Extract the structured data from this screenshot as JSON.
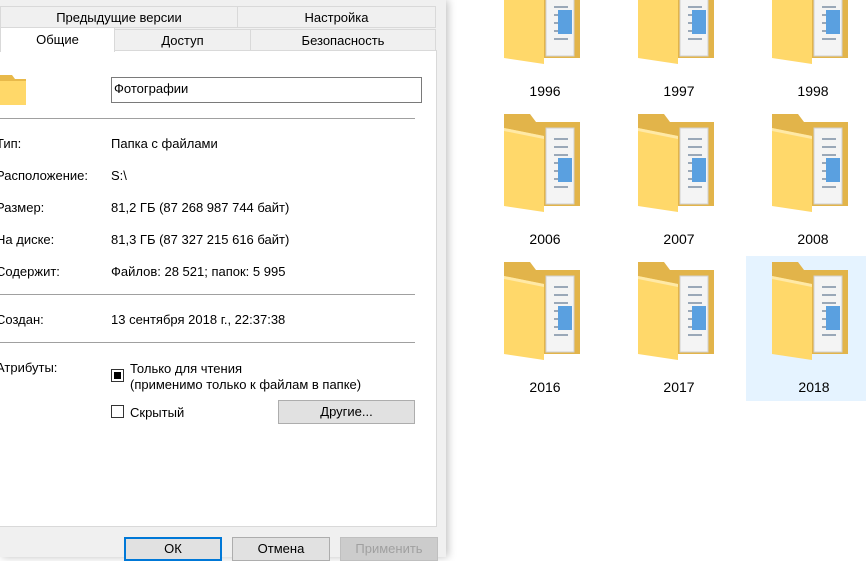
{
  "dialog": {
    "tabs_row1": [
      "Предыдущие версии",
      "Настройка"
    ],
    "tabs_row2": [
      "Общие",
      "Доступ",
      "Безопасность"
    ],
    "folder_name": "Фотографии",
    "props": {
      "type_label": "Тип:",
      "type_value": "Папка с файлами",
      "location_label": "Расположение:",
      "location_value": "S:\\",
      "size_label": "Размер:",
      "size_value": "81,2 ГБ (87 268 987 744 байт)",
      "disk_label": "На диске:",
      "disk_value": "81,3 ГБ (87 327 215 616 байт)",
      "contains_label": "Содержит:",
      "contains_value": "Файлов: 28 521; папок: 5 995",
      "created_label": "Создан:",
      "created_value": "13 сентября 2018 г., 22:37:38",
      "attributes_label": "Атрибуты:"
    },
    "readonly_label": "Только для чтения",
    "readonly_note": "(применимо только к файлам в папке)",
    "readonly_state": "indeterminate",
    "hidden_label": "Скрытый",
    "hidden_checked": false,
    "advanced_button": "Другие...",
    "ok_button": "ОК",
    "cancel_button": "Отмена",
    "apply_button": "Применить"
  },
  "folders": {
    "items": [
      "1996",
      "1997",
      "1998",
      "2006",
      "2007",
      "2008",
      "2016",
      "2017",
      "2018"
    ],
    "selected": "2018"
  }
}
